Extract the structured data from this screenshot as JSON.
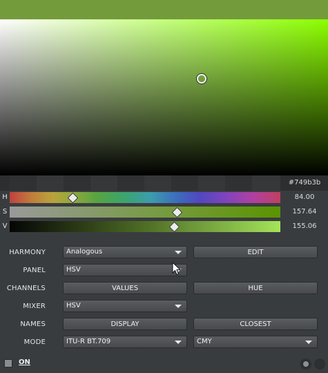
{
  "color": {
    "current_hex": "#749b3b",
    "hex_label": "#749b3b"
  },
  "sliders": [
    {
      "letter": "H",
      "value": "84.00",
      "level_fraction": 0.233
    },
    {
      "letter": "S",
      "value": "157.64",
      "level_fraction": 0.618
    },
    {
      "letter": "V",
      "value": "155.06",
      "level_fraction": 0.608
    }
  ],
  "rows": {
    "harmony": {
      "label": "HARMONY",
      "dropdown_value": "Analogous",
      "button_label": "EDIT"
    },
    "panel": {
      "label": "PANEL",
      "dropdown_value": "HSV"
    },
    "channels": {
      "label": "CHANNELS",
      "button1_label": "VALUES",
      "button2_label": "HUE"
    },
    "mixer": {
      "label": "MIXER",
      "dropdown_value": "HSV"
    },
    "names": {
      "label": "NAMES",
      "button1_label": "DISPLAY",
      "button2_label": "CLOSEST"
    },
    "mode": {
      "label": "MODE",
      "dropdown1_value": "ITU-R BT.709",
      "dropdown2_value": "CMY"
    }
  },
  "footer": {
    "on_label": "ON"
  }
}
